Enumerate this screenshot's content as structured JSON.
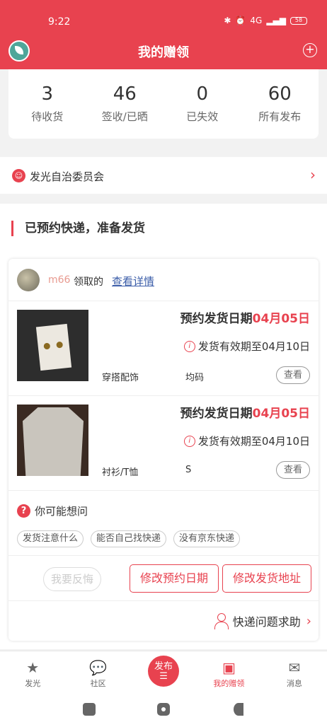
{
  "status_bar": {
    "time": "9:22",
    "network": "4G",
    "battery": "58"
  },
  "header": {
    "title": "我的赠领",
    "add_icon": "plus-circle-icon",
    "logo_icon": "leaf-logo-icon"
  },
  "stats": [
    {
      "value": "3",
      "label": "待收货"
    },
    {
      "value": "46",
      "label": "签收/已晒"
    },
    {
      "value": "0",
      "label": "已失效"
    },
    {
      "value": "60",
      "label": "所有发布"
    }
  ],
  "committee": {
    "label": "发光自治委员会"
  },
  "section": {
    "title": "已预约快递，准备发货"
  },
  "claim": {
    "user": "m66",
    "claimed_text": "领取的",
    "details_link": "查看详情",
    "items": [
      {
        "date_prefix": "预约发货日期",
        "date": "04月05日",
        "valid_text": "发货有效期至04月10日",
        "category": "穿搭配饰",
        "size": "均码",
        "view": "查看"
      },
      {
        "date_prefix": "预约发货日期",
        "date": "04月05日",
        "valid_text": "发货有效期至04月10日",
        "category": "衬衫/T恤",
        "size": "S",
        "view": "查看"
      }
    ],
    "faq_title": "你可能想问",
    "faq_chips": [
      "发货注意什么",
      "能否自己找快递",
      "没有京东快递"
    ],
    "regret_button": "我要反悔",
    "change_date_button": "修改预约日期",
    "change_address_button": "修改发货地址",
    "help_text": "快递问题求助"
  },
  "nav": [
    {
      "label": "发光",
      "icon": "star-icon"
    },
    {
      "label": "社区",
      "icon": "chat-icon"
    },
    {
      "label": "发布",
      "icon": "publish-button"
    },
    {
      "label": "我的赠领",
      "icon": "gift-box-icon"
    },
    {
      "label": "消息",
      "icon": "mail-icon"
    }
  ],
  "colors": {
    "accent": "#e8424f",
    "link": "#3a5ca8"
  }
}
